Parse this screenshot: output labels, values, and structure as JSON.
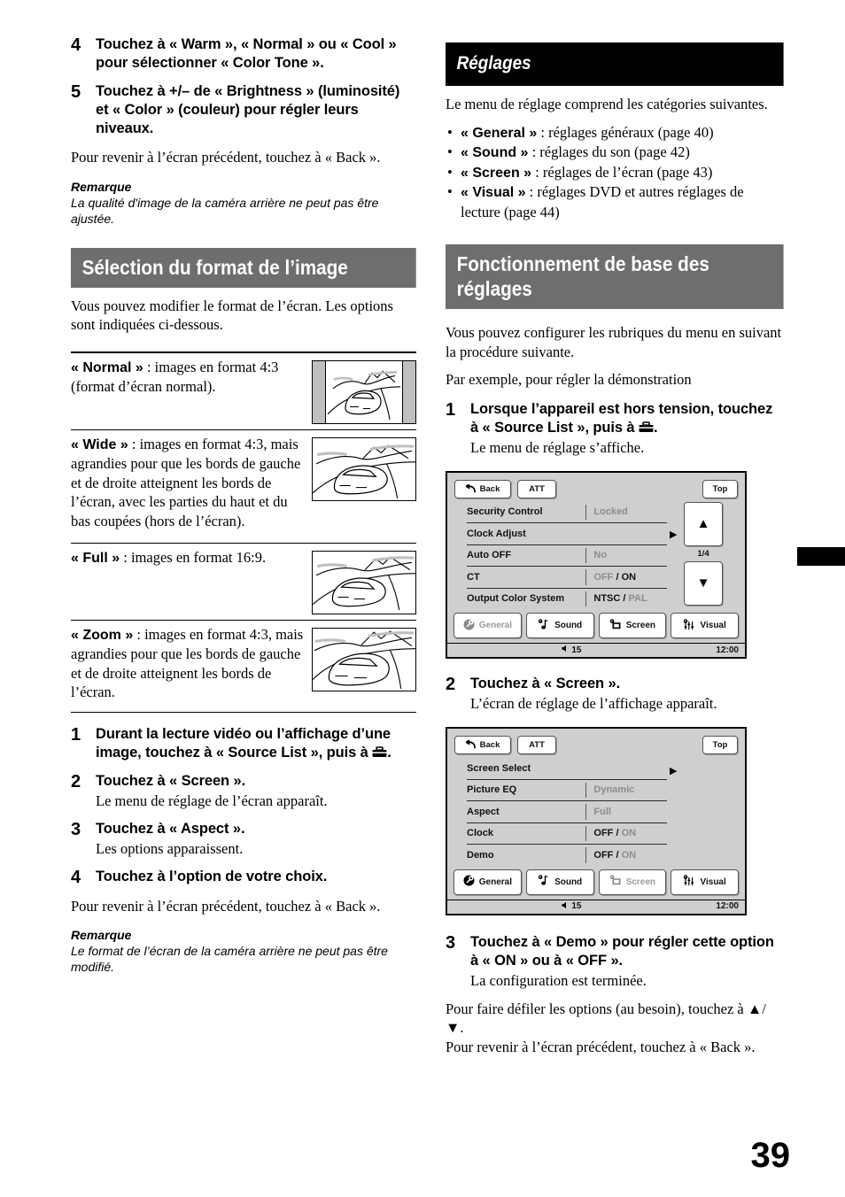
{
  "page": {
    "number": "39",
    "edge_tab": true
  },
  "left_column": {
    "steps_top": [
      {
        "num": "4",
        "title": "Touchez à « Warm », « Normal » ou « Cool » pour sélectionner « Color Tone »."
      },
      {
        "num": "5",
        "title": "Touchez à +/– de « Brightness » (luminosité) et « Color » (couleur) pour régler leurs niveaux."
      }
    ],
    "back_note": "Pour revenir à l’écran précédent, touchez à « Back ».",
    "remark": {
      "heading": "Remarque",
      "text": "La qualité d'image de la caméra arrière ne peut pas être ajustée."
    },
    "section_header": "Sélection du format de l’image",
    "intro": "Vous pouvez modifier le format de l’écran. Les options sont indiquées ci-dessous.",
    "formats": [
      {
        "name": "« Normal »",
        "desc": " : images en format 4:3 (format d’écran normal).",
        "thumb": "normal-pillarbox"
      },
      {
        "name": "« Wide »",
        "desc": " : images en format 4:3, mais agrandies pour que les bords de gauche et de droite atteignent les bords de l’écran, avec les parties du haut et du bas coupées (hors de l’écran).",
        "thumb": "wide-full"
      },
      {
        "name": "« Full »",
        "desc": " : images en format 16:9.",
        "thumb": "full-169"
      },
      {
        "name": "« Zoom »",
        "desc": " : images en format 4:3, mais agrandies pour que les bords de gauche et de droite atteignent les bords de l’écran.",
        "thumb": "zoom-crop"
      }
    ],
    "steps_bottom": [
      {
        "num": "1",
        "title": "Durant la lecture vidéo ou l’affichage d’une image, touchez à « Source List », puis à ",
        "icon": "toolbox-icon",
        "title_tail": "."
      },
      {
        "num": "2",
        "title": "Touchez à « Screen ».",
        "sub": "Le menu de réglage de l’écran apparaît."
      },
      {
        "num": "3",
        "title": "Touchez à « Aspect ».",
        "sub": "Les options apparaissent."
      },
      {
        "num": "4",
        "title": "Touchez à l’option de votre choix."
      }
    ],
    "back_note2": "Pour revenir à l’écran précédent, touchez à « Back ».",
    "remark2": {
      "heading": "Remarque",
      "text": "Le format de l’écran de la caméra arrière ne peut pas être modifié."
    }
  },
  "right_column": {
    "header_black": "Réglages",
    "intro": "Le menu de réglage comprend les catégories suivantes.",
    "categories": [
      {
        "name": "« General »",
        "desc": " : réglages généraux (page 40)"
      },
      {
        "name": "« Sound »",
        "desc": " : réglages du son (page 42)"
      },
      {
        "name": "« Screen »",
        "desc": " : réglages de l’écran (page 43)"
      },
      {
        "name": "« Visual »",
        "desc": " : réglages DVD et autres réglages de lecture (page 44)"
      }
    ],
    "header_gray": "Fonctionnement de base des réglages",
    "intro2": "Vous pouvez configurer les rubriques du menu en suivant la procédure suivante.",
    "example": "Par exemple, pour régler la démonstration",
    "step1": {
      "num": "1",
      "title_head": "Lorsque l’appareil est hors tension, touchez à « Source List », puis à ",
      "icon": "toolbox-icon",
      "title_tail": ".",
      "sub": "Le menu de réglage s’affiche."
    },
    "step2": {
      "num": "2",
      "title": "Touchez à « Screen ».",
      "sub": "L’écran de réglage de l’affichage apparaît."
    },
    "step3": {
      "num": "3",
      "title": "Touchez à « Demo » pour régler cette option à « ON » ou à « OFF ».",
      "sub": "La configuration est terminée."
    },
    "scroll_note": "Pour faire défiler les options (au besoin), touchez à ▲/▼.",
    "back_note": "Pour revenir à l’écran précédent, touchez à « Back »."
  },
  "device_screen_1": {
    "back_label": "Back",
    "att_label": "ATT",
    "top_label": "Top",
    "page_indicator": "1/4",
    "up_arrow": "▲",
    "down_arrow": "▼",
    "caret": "▶",
    "rows": [
      {
        "label": "Security Control",
        "value_dim": "Locked",
        "value_on": "",
        "caret": false
      },
      {
        "label": "Clock Adjust",
        "value_dim": "",
        "value_on": "",
        "caret": true
      },
      {
        "label": "Auto OFF",
        "value_dim": "No",
        "value_on": "",
        "caret": false
      },
      {
        "label": "CT",
        "value_dim": "OFF",
        "value_on": "ON",
        "caret": false
      },
      {
        "label": "Output Color System",
        "value_dim": "PAL",
        "value_on": "NTSC",
        "caret": false
      }
    ],
    "tabs": [
      {
        "label": "General",
        "icon": "general-wrench-icon",
        "active": true
      },
      {
        "label": "Sound",
        "icon": "sound-note-icon",
        "active": false
      },
      {
        "label": "Screen",
        "icon": "screen-monitor-icon",
        "active": false
      },
      {
        "label": "Visual",
        "icon": "visual-sliders-icon",
        "active": false
      }
    ],
    "volume": "15",
    "clock": "12:00"
  },
  "device_screen_2": {
    "back_label": "Back",
    "att_label": "ATT",
    "top_label": "Top",
    "caret": "▶",
    "rows": [
      {
        "label": "Screen Select",
        "value_dim": "",
        "value_on": "",
        "caret": true
      },
      {
        "label": "Picture EQ",
        "value_dim": "Dynamic",
        "value_on": "",
        "caret": false
      },
      {
        "label": "Aspect",
        "value_dim": "Full",
        "value_on": "",
        "caret": false
      },
      {
        "label": "Clock",
        "value_dim": "ON",
        "value_on": "OFF",
        "caret": false
      },
      {
        "label": "Demo",
        "value_dim": "ON",
        "value_on": "OFF",
        "caret": false
      }
    ],
    "tabs": [
      {
        "label": "General",
        "icon": "general-wrench-icon",
        "active": false
      },
      {
        "label": "Sound",
        "icon": "sound-note-icon",
        "active": false
      },
      {
        "label": "Screen",
        "icon": "screen-monitor-icon",
        "active": true
      },
      {
        "label": "Visual",
        "icon": "visual-sliders-icon",
        "active": false
      }
    ],
    "volume": "15",
    "clock": "12:00"
  },
  "colors": {
    "header_gray": "#6e6e6e",
    "header_black": "#000000",
    "device_bg": "#cfcfcf",
    "dim_text": "#8c8c8c"
  }
}
